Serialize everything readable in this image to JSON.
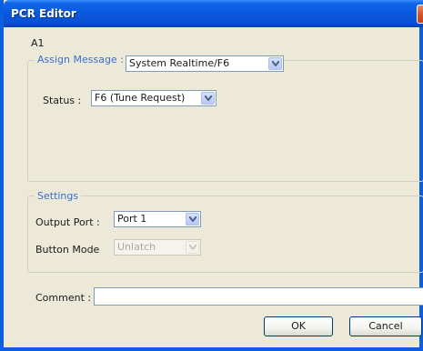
{
  "window": {
    "title": "PCR Editor",
    "close_symbol": "✕"
  },
  "header": {
    "id": "A1"
  },
  "assign": {
    "caption": "Assign Message :",
    "message_value": "System Realtime/F6",
    "status_label": "Status :",
    "status_value": "F6 (Tune Request)"
  },
  "settings": {
    "caption": "Settings",
    "output_port_label": "Output Port :",
    "output_port_value": "Port 1",
    "button_mode_label": "Button Mode",
    "button_mode_value": "Unlatch"
  },
  "comment": {
    "label": "Comment :",
    "value": ""
  },
  "buttons": {
    "ok": "OK",
    "cancel": "Cancel"
  },
  "colors": {
    "title_bar": "#0a58de",
    "group_caption": "#3a6fd0",
    "dialog_bg": "#ece9d8"
  }
}
